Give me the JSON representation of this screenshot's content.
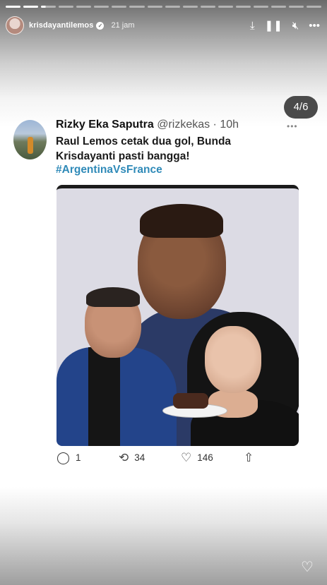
{
  "story": {
    "username": "krisdayantilemos",
    "time": "21 jam",
    "segments": 6,
    "current_segment": 4,
    "icons": [
      "download-icon",
      "pause-icon",
      "mute-icon",
      "more-icon"
    ]
  },
  "page_indicator": "4/6",
  "tweet": {
    "name": "Rizky Eka Saputra",
    "handle_time": "@rizkekas · 10h",
    "text": "Raul Lemos cetak dua gol, Bunda Krisdayanti pasti bangga!",
    "hashtag": "#ArgentinaVsFrance",
    "actions": {
      "replies": "1",
      "retweets": "34",
      "likes": "146"
    }
  }
}
